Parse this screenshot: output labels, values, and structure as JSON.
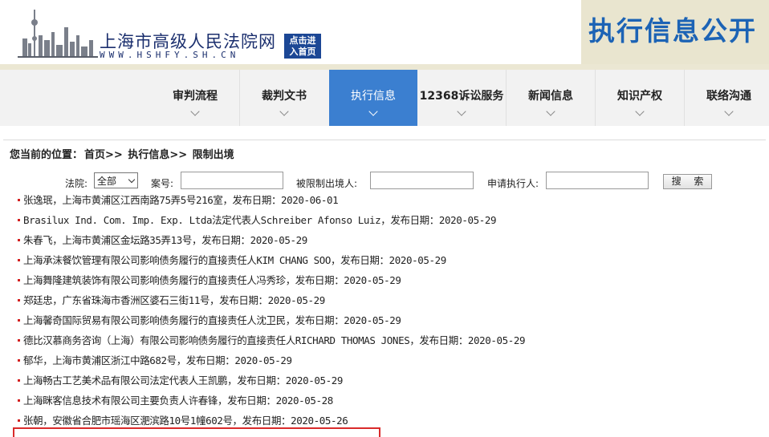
{
  "header": {
    "site_title": "上海市高级人民法院网",
    "site_domain": "WWW.HSHFY.SH.CN",
    "enter_button_line1": "点击进",
    "enter_button_line2": "入首页",
    "banner_text": "执行信息公开",
    "colors": {
      "brand_blue": "#1c4795",
      "banner_bg": "#e9e5cf",
      "banner_text": "#1c63b5"
    }
  },
  "nav": {
    "items": [
      {
        "label": "审判流程"
      },
      {
        "label": "裁判文书"
      },
      {
        "label": "执行信息",
        "active": true
      },
      {
        "label": "12368诉讼服务"
      },
      {
        "label": "新闻信息"
      },
      {
        "label": "知识产权"
      },
      {
        "label": "联络沟通"
      }
    ],
    "active_color": "#3b7fd0"
  },
  "breadcrumb": {
    "prefix": "您当前的位置：",
    "home": "首页>>",
    "section": "执行信息>>",
    "current": "限制出境"
  },
  "search": {
    "court_label": "法院:",
    "court_value": "全部",
    "case_label": "案号:",
    "restricted_label": "被限制出境人:",
    "applicant_label": "申请执行人:",
    "button_label": "搜 索"
  },
  "list": [
    "张逸珉，上海市黄浦区江西南路75弄5号216室，发布日期：2020-06-01",
    "Brasilux Ind. Com. Imp. Exp. Ltda法定代表人Schreiber Afonso Luiz，发布日期：2020-05-29",
    "朱春飞，上海市黄浦区金坛路35弄13号，发布日期：2020-05-29",
    "上海承沫餐饮管理有限公司影响债务履行的直接责任人KIM CHANG SOO，发布日期：2020-05-29",
    "上海舞隆建筑装饰有限公司影响债务履行的直接责任人冯秀珍，发布日期：2020-05-29",
    "郑廷忠，广东省珠海市香洲区婆石三街11号，发布日期：2020-05-29",
    "上海馨奇国际贸易有限公司影响债务履行的直接责任人沈卫民，发布日期：2020-05-29",
    "德比汉慕商务咨询（上海）有限公司影响债务履行的直接责任人RICHARD THOMAS JONES，发布日期：2020-05-29",
    "郁华，上海市黄浦区浙江中路682号，发布日期：2020-05-29",
    "上海畅古工艺美术品有限公司法定代表人王凯鹏，发布日期：2020-05-29",
    "上海眯客信息技术有限公司主要负责人许春锋，发布日期：2020-05-28",
    "张朝，安徽省合肥市瑶海区淝滨路10号1幢602号，发布日期：2020-05-26"
  ],
  "list_bullet_color": "#d32020",
  "highlight_color": "#d92b2b"
}
